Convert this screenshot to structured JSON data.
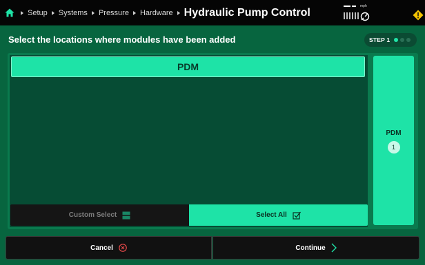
{
  "header": {
    "home_icon": "home-icon",
    "breadcrumbs": [
      "Setup",
      "Systems",
      "Pressure",
      "Hardware"
    ],
    "title": "Hydraulic Pump Control",
    "speed_unit": "mph",
    "status_icons": [
      "signal-bars-icon",
      "gauge-icon",
      "warning-icon"
    ]
  },
  "main": {
    "heading": "Select the locations where modules have been added",
    "step": {
      "label": "STEP 1",
      "total": 3,
      "current": 1
    },
    "module_bar_label": "PDM",
    "custom_select_label": "Custom Select",
    "select_all_label": "Select All",
    "side_card": {
      "label": "PDM",
      "count": "1"
    }
  },
  "footer": {
    "cancel_label": "Cancel",
    "continue_label": "Continue"
  },
  "colors": {
    "accent": "#1ee3a7",
    "background": "#07653f",
    "topbar": "#050505",
    "warning": "#f5c400",
    "cancel_icon": "#e84a4a"
  }
}
